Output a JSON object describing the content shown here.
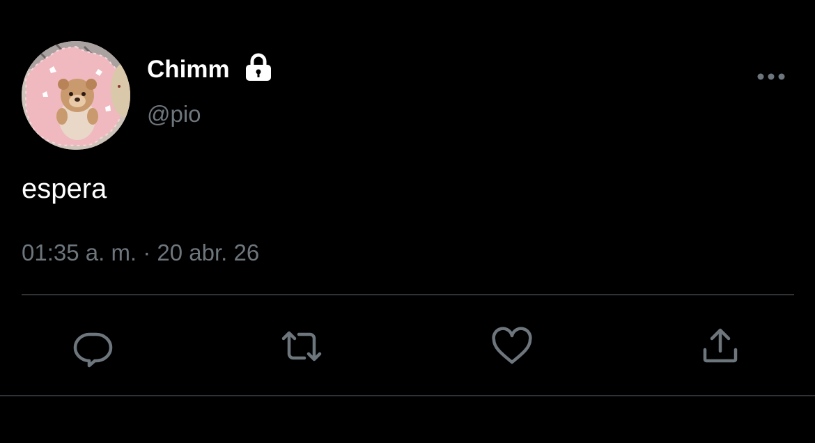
{
  "user": {
    "display_name": "Chimm",
    "handle": "@pio",
    "avatar_icon": "avatar-photo",
    "protected_icon": "lock-icon"
  },
  "tweet": {
    "text": "espera",
    "timestamp": "01:35 a. m. · 20 abr. 26"
  },
  "actions": {
    "reply_icon": "reply-icon",
    "retweet_icon": "retweet-icon",
    "like_icon": "heart-icon",
    "share_icon": "share-icon",
    "more_icon": "more-icon"
  },
  "colors": {
    "background": "#000000",
    "primary_text": "#ffffff",
    "secondary_text": "#6e767d",
    "divider": "#2f3336"
  }
}
